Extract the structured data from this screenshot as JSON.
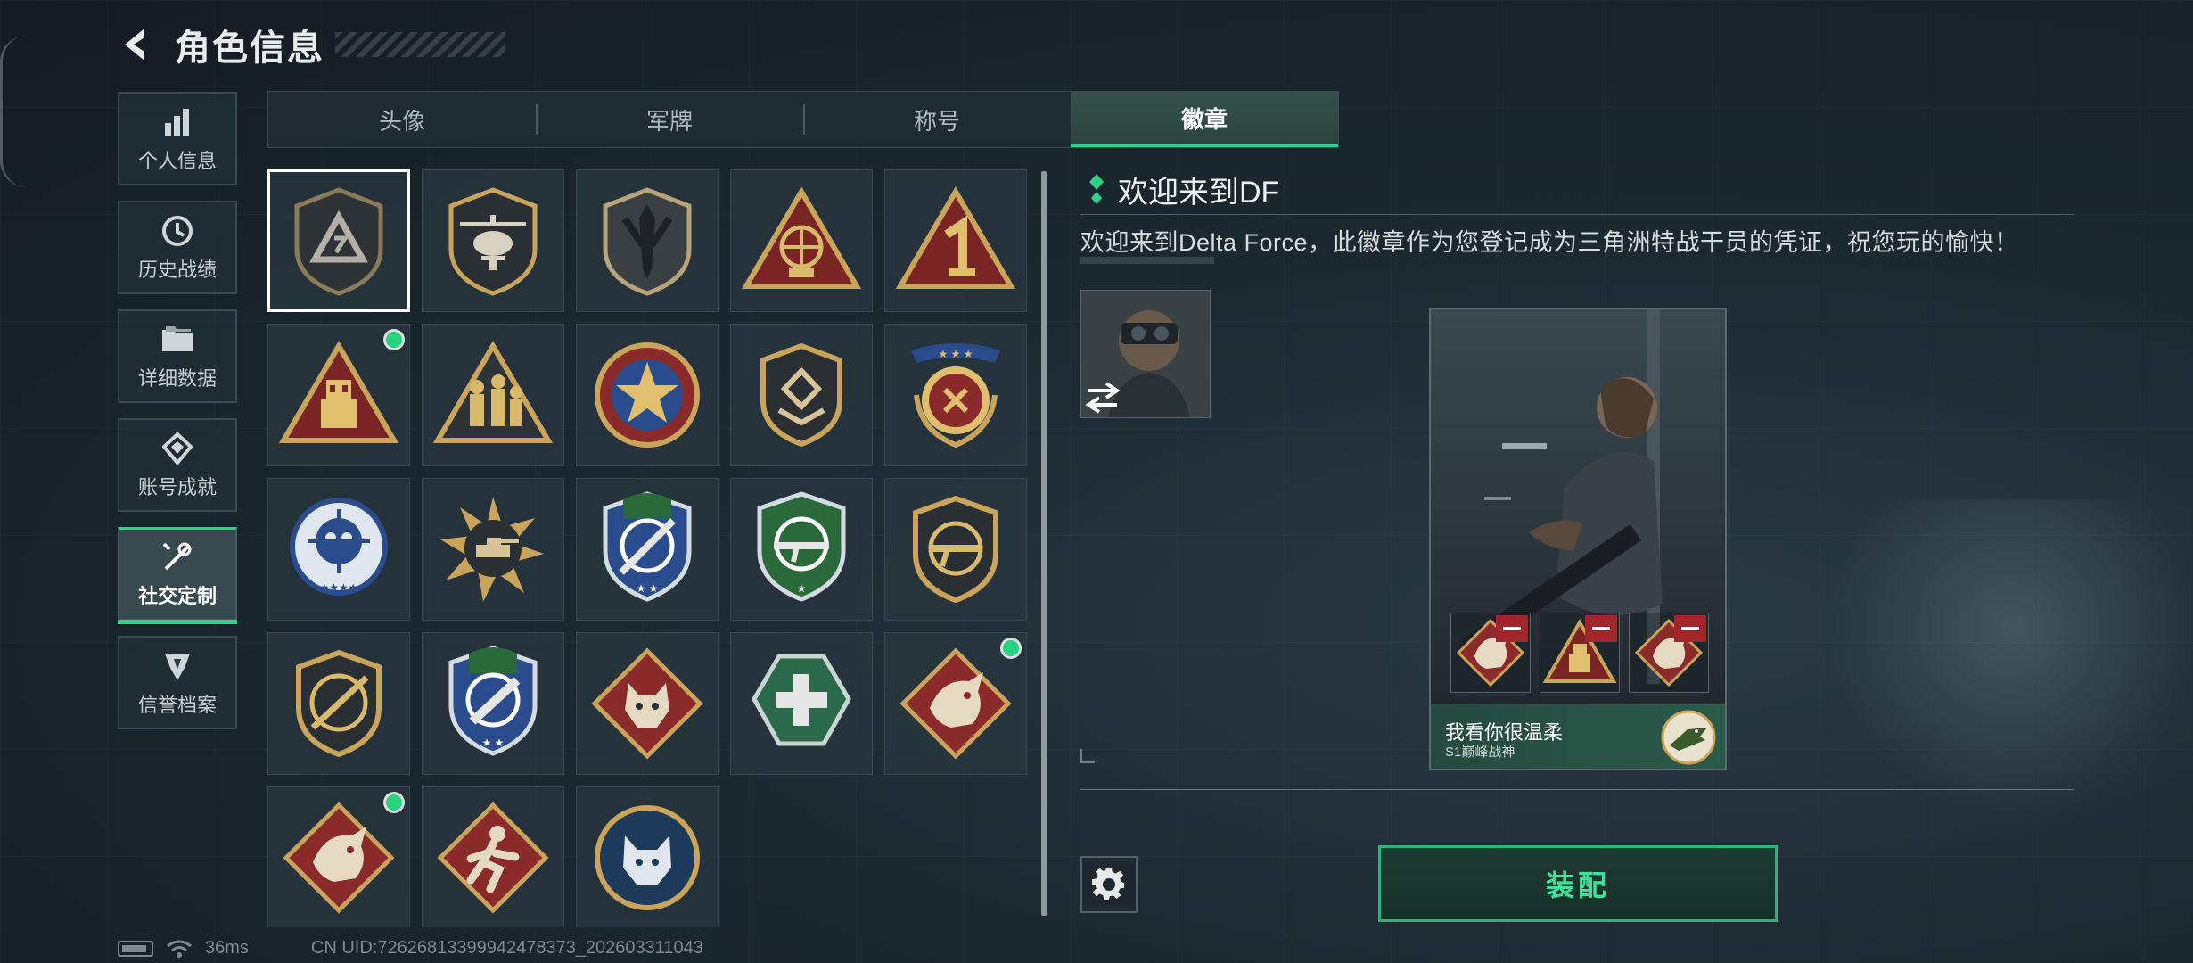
{
  "header": {
    "title": "角色信息"
  },
  "sidebar": {
    "items": [
      {
        "label": "个人信息",
        "icon": "bar-chart-icon",
        "active": false
      },
      {
        "label": "历史战绩",
        "icon": "history-icon",
        "active": false
      },
      {
        "label": "详细数据",
        "icon": "folder-icon",
        "active": false
      },
      {
        "label": "账号成就",
        "icon": "achievement-icon",
        "active": false
      },
      {
        "label": "社交定制",
        "icon": "tools-icon",
        "active": true
      },
      {
        "label": "信誉档案",
        "icon": "credit-icon",
        "active": false
      }
    ]
  },
  "tabs": [
    {
      "label": "头像",
      "active": false
    },
    {
      "label": "军牌",
      "active": false
    },
    {
      "label": "称号",
      "active": false
    },
    {
      "label": "徽章",
      "active": true
    }
  ],
  "badges": [
    {
      "icon": "shield-triangle-badge",
      "selected": true,
      "new": false
    },
    {
      "icon": "helicopter-badge",
      "selected": false,
      "new": false
    },
    {
      "icon": "dagger-shield-badge",
      "selected": false,
      "new": false
    },
    {
      "icon": "satellite-triangle-badge",
      "selected": false,
      "new": false
    },
    {
      "icon": "number-one-triangle-badge",
      "selected": false,
      "new": false
    },
    {
      "icon": "usb-triangle-badge",
      "selected": false,
      "new": true
    },
    {
      "icon": "soldiers-triangle-badge",
      "selected": false,
      "new": false
    },
    {
      "icon": "star-circle-badge",
      "selected": false,
      "new": false
    },
    {
      "icon": "emblem-shield-badge",
      "selected": false,
      "new": false
    },
    {
      "icon": "laurel-crest-badge",
      "selected": false,
      "new": false
    },
    {
      "icon": "skull-crosshair-badge",
      "selected": false,
      "new": false
    },
    {
      "icon": "tank-sunburst-badge",
      "selected": false,
      "new": false
    },
    {
      "icon": "rifle-blue-shield-badge",
      "selected": false,
      "new": false
    },
    {
      "icon": "rifle-green-shield-badge",
      "selected": false,
      "new": false
    },
    {
      "icon": "rifle-gold-shield-badge",
      "selected": false,
      "new": false
    },
    {
      "icon": "sniper-gold-shield-badge",
      "selected": false,
      "new": false
    },
    {
      "icon": "knife-blue-shield-badge",
      "selected": false,
      "new": false
    },
    {
      "icon": "wolf-diamond-badge",
      "selected": false,
      "new": false
    },
    {
      "icon": "medic-hexagon-badge",
      "selected": false,
      "new": false
    },
    {
      "icon": "dragon-diamond-badge",
      "selected": false,
      "new": true
    },
    {
      "icon": "dragon-diamond-badge-2",
      "selected": false,
      "new": true
    },
    {
      "icon": "runner-diamond-badge",
      "selected": false,
      "new": false
    },
    {
      "icon": "wolf-circle-badge",
      "selected": false,
      "new": false
    }
  ],
  "detail": {
    "title": "欢迎来到DF",
    "description": "欢迎来到Delta Force，此徽章作为您登记成为三角洲特战干员的凭证，祝您玩的愉快！"
  },
  "preview_card": {
    "name": "我看你很温柔",
    "subtitle": "S1巅峰战神"
  },
  "buttons": {
    "equip": "装配"
  },
  "status": {
    "ping": "36ms",
    "uid": "CN UID:7262681339994247837​3_202603311043"
  },
  "colors": {
    "accent": "#2ed18a",
    "badge_red": "#8a2a2a",
    "badge_gold": "#c9a45a",
    "badge_blue": "#2b4c8c",
    "badge_green": "#2a6a3a"
  }
}
